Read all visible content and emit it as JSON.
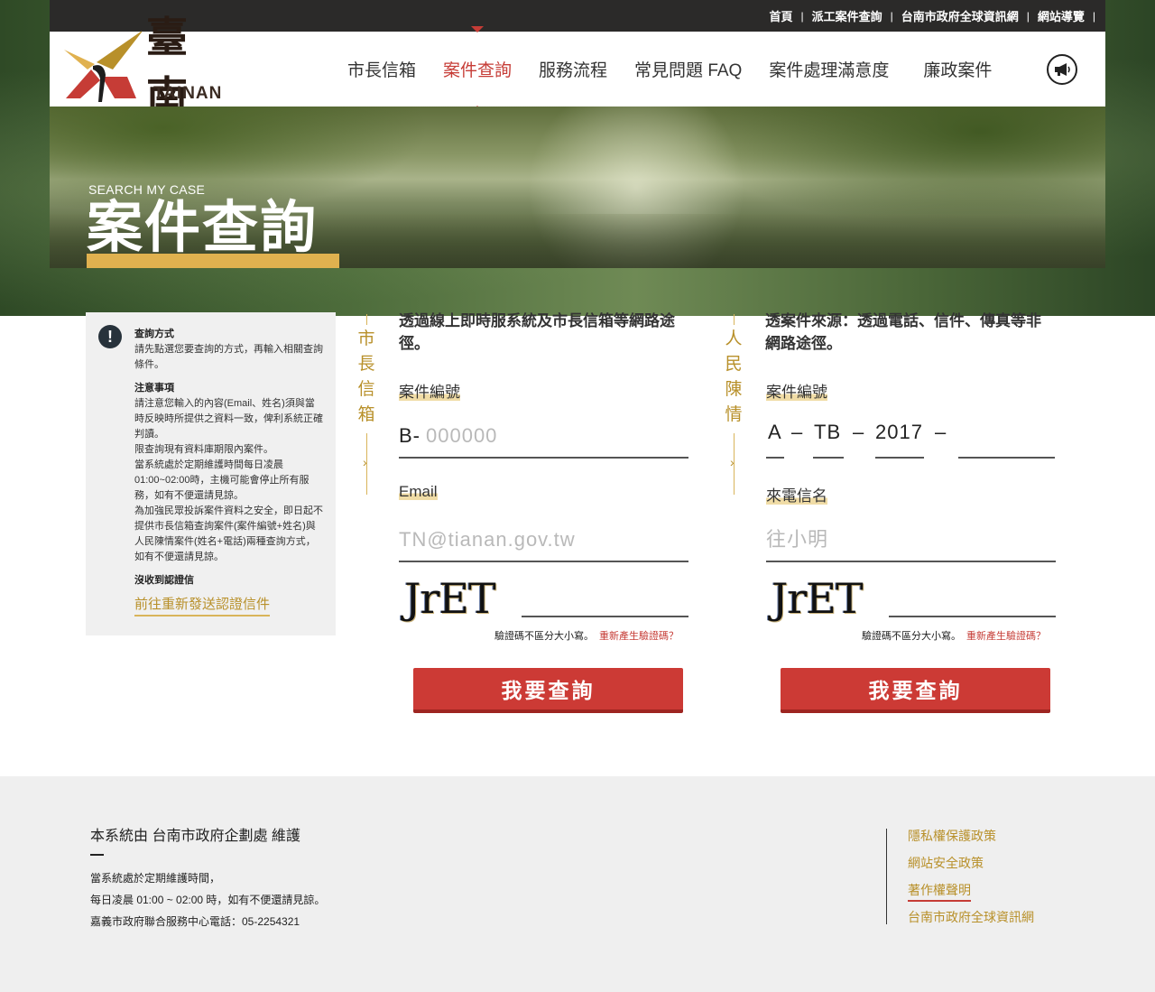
{
  "topbar": {
    "links": [
      "首頁",
      "派工案件查詢",
      "台南市政府全球資訊網",
      "網站導覽"
    ]
  },
  "logo": {
    "chars": "臺南",
    "en": "TAINAN"
  },
  "nav": {
    "items": [
      "市長信箱",
      "案件查詢",
      "服務流程",
      "常見問題 FAQ",
      "案件處理滿意度",
      "廉政案件"
    ],
    "active_index": 1
  },
  "hero": {
    "subtitle": "SEARCH MY CASE",
    "title": "案件查詢"
  },
  "info": {
    "h1": "查詢方式",
    "t1": "請先點選您要查詢的方式，再輸入相關查詢條件。",
    "h2": "注意事項",
    "t2a": "請注意您輸入的內容(Email、姓名)須與當時反映時所提供之資料一致，俾利系統正確判讀。",
    "t2b": "限查詢現有資料庫期限內案件。",
    "t2c": "當系統處於定期維護時間每日凌晨01:00~02:00時，主機可能會停止所有服務，如有不便還請見諒。",
    "t2d": "為加強民眾投訴案件資料之安全，即日起不提供市長信箱查詢案件(案件編號+姓名)與人民陳情案件(姓名+電話)兩種查詢方式，如有不便還請見諒。",
    "h3": "沒收到認證信",
    "link": "前往重新發送認證信件"
  },
  "form_left": {
    "vtitle": [
      "市",
      "長",
      "信",
      "箱"
    ],
    "heading": "透過線上即時服系統及市長信箱等網路途徑。",
    "case_label": "案件編號",
    "case_prefix": "B-",
    "case_placeholder": "000000",
    "email_label": "Email",
    "email_placeholder": "TN@tianan.gov.tw",
    "captcha_text": "JrET",
    "captcha_note": "驗證碼不區分大小寫。",
    "captcha_regen": "重新產生驗證碼？",
    "submit": "我要查詢"
  },
  "form_right": {
    "vtitle": [
      "人",
      "民",
      "陳",
      "情"
    ],
    "heading": "透案件來源：透過電話、信件、傳真等非網路途徑。",
    "case_label": "案件編號",
    "seg_a": "A",
    "seg_tb": "TB",
    "seg_year": "2017",
    "dash": "–",
    "name_label": "來電信名",
    "name_placeholder": "往小明",
    "captcha_text": "JrET",
    "captcha_note": "驗證碼不區分大小寫。",
    "captcha_regen": "重新產生驗證碼？",
    "submit": "我要查詢"
  },
  "footer": {
    "maintained": "本系統由 台南市政府企劃處 維護",
    "line1": "當系統處於定期維護時間，",
    "line2": "每日凌晨 01:00 ~ 02:00 時，如有不便還請見諒。",
    "line3": "嘉義市政府聯合服務中心電話：05-2254321",
    "links": [
      "隱私權保護政策",
      "網站安全政策",
      "著作權聲明",
      "台南市政府全球資訊網"
    ],
    "active_link_index": 2
  },
  "colors": {
    "accent_red": "#cc3a35",
    "accent_gold": "#b8902a",
    "topbar": "#2b2a29"
  }
}
